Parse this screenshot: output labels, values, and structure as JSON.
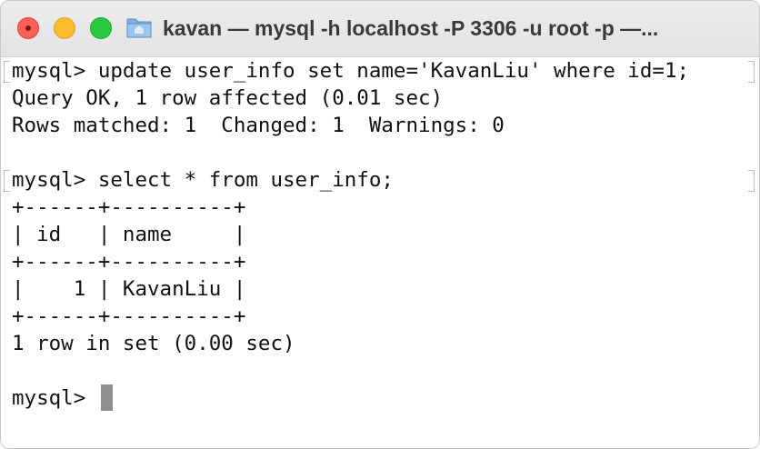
{
  "window": {
    "title": "kavan — mysql -h localhost -P 3306 -u root -p —..."
  },
  "colors": {
    "close": "#fe5f57",
    "minimize": "#febc2e",
    "maximize": "#28c840",
    "folder": "#7fb0e0",
    "cursor": "#8f8f8f"
  },
  "icons": {
    "folder": "folder-icon"
  },
  "terminal": {
    "lines": [
      "mysql> update user_info set name='KavanLiu' where id=1;",
      "Query OK, 1 row affected (0.01 sec)",
      "Rows matched: 1  Changed: 1  Warnings: 0",
      "",
      "mysql> select * from user_info;",
      "+------+----------+",
      "| id   | name     |",
      "+------+----------+",
      "|    1 | KavanLiu |",
      "+------+----------+",
      "1 row in set (0.00 sec)",
      "",
      "mysql> "
    ]
  }
}
